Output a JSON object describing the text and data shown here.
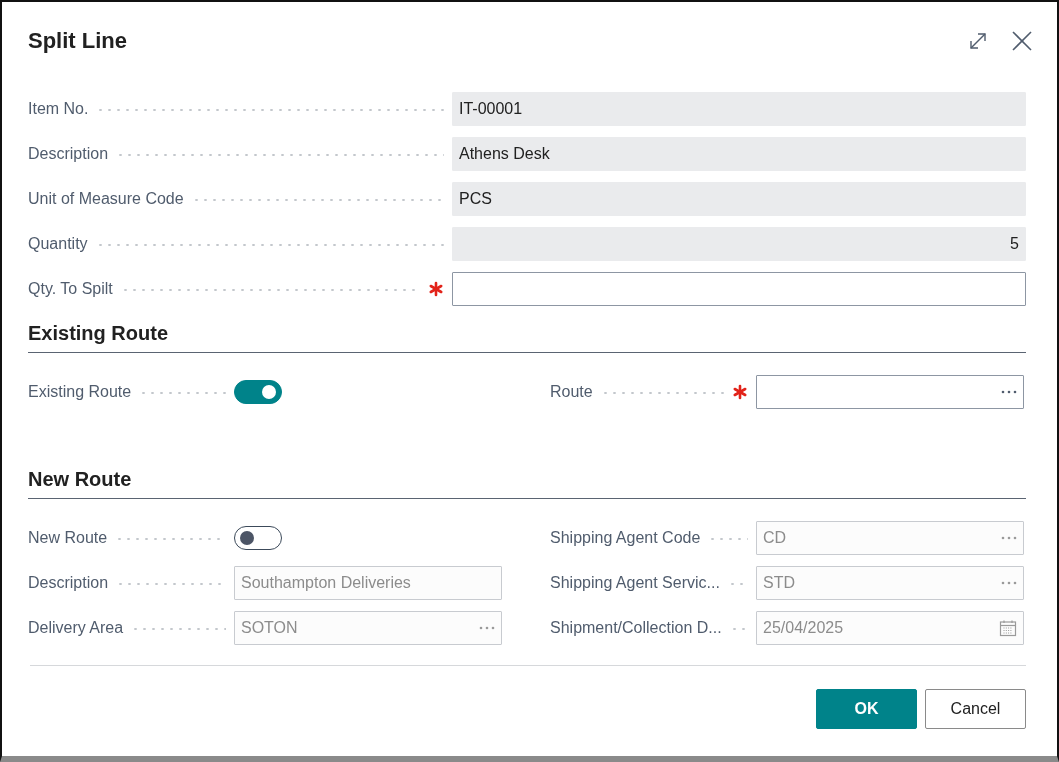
{
  "dialog": {
    "title": "Split Line"
  },
  "fields": [
    {
      "label": "Item No.",
      "kind": "text",
      "value": "IT-00001",
      "editable": false,
      "required": false
    },
    {
      "label": "Description",
      "kind": "text",
      "value": "Athens Desk",
      "editable": false,
      "required": false
    },
    {
      "label": "Unit of Measure Code",
      "kind": "text",
      "value": "PCS",
      "editable": false,
      "required": false
    },
    {
      "label": "Quantity",
      "kind": "number",
      "value": "5",
      "editable": false,
      "required": false
    },
    {
      "label": "Qty. To Spilt",
      "kind": "text",
      "editable": true,
      "required": true
    }
  ],
  "sections": [
    {
      "title": "Existing Route",
      "left": [
        {
          "label": "Existing Route",
          "kind": "toggle",
          "on": true,
          "disabled": false
        }
      ],
      "right": [
        {
          "label": "Route",
          "kind": "lookup",
          "required": true,
          "disabled": false
        }
      ]
    },
    {
      "title": "New Route",
      "left": [
        {
          "label": "New Route",
          "kind": "toggle",
          "on": false,
          "disabled": false
        },
        {
          "label": "Description",
          "kind": "text",
          "value": "Southampton Deliveries",
          "disabled": true
        },
        {
          "label": "Delivery Area",
          "kind": "lookup",
          "value": "SOTON",
          "disabled": true
        }
      ],
      "right": [
        {
          "label": "Shipping Agent Code",
          "kind": "lookup",
          "value": "CD",
          "disabled": true
        },
        {
          "label": "Shipping Agent Servic...",
          "kind": "lookup",
          "value": "STD",
          "disabled": true
        },
        {
          "label": "Shipment/Collection D...",
          "kind": "date",
          "value": "25/04/2025",
          "disabled": true
        }
      ]
    }
  ],
  "buttons": [
    {
      "label": "OK",
      "primary": true
    },
    {
      "label": "Cancel",
      "primary": false
    }
  ]
}
